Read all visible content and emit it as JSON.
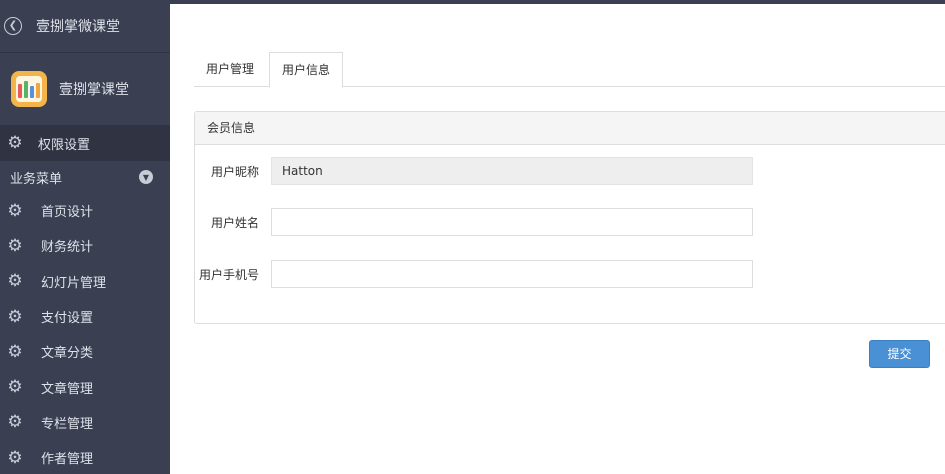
{
  "app": {
    "back_title": "壹捌掌微课堂",
    "brand_name": "壹捌掌课堂",
    "logo_icon": "books-logo-icon"
  },
  "sidebar": {
    "permission_label": "权限设置",
    "group_label": "业务菜单",
    "items": [
      {
        "label": "首页设计",
        "icon": "gear-icon"
      },
      {
        "label": "财务统计",
        "icon": "gear-icon"
      },
      {
        "label": "幻灯片管理",
        "icon": "gear-icon"
      },
      {
        "label": "支付设置",
        "icon": "gear-icon"
      },
      {
        "label": "文章分类",
        "icon": "gear-icon"
      },
      {
        "label": "文章管理",
        "icon": "gear-icon"
      },
      {
        "label": "专栏管理",
        "icon": "gear-icon"
      },
      {
        "label": "作者管理",
        "icon": "gear-icon"
      }
    ]
  },
  "tabs": [
    {
      "label": "用户管理",
      "active": false
    },
    {
      "label": "用户信息",
      "active": true
    }
  ],
  "panel": {
    "title": "会员信息",
    "fields": [
      {
        "label": "用户昵称",
        "value": "Hatton",
        "readonly": true
      },
      {
        "label": "用户姓名",
        "value": "",
        "readonly": false
      },
      {
        "label": "用户手机号",
        "value": "",
        "readonly": false
      }
    ]
  },
  "actions": {
    "submit_label": "提交"
  },
  "colors": {
    "sidebar_bg": "#3a3f51",
    "accent": "#4a90d4"
  }
}
